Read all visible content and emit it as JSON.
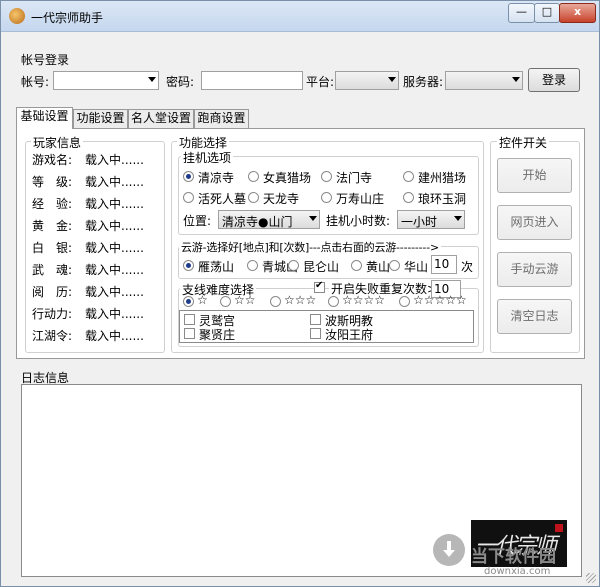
{
  "window": {
    "title": "一代宗师助手",
    "min_glyph": "—",
    "max_glyph": "□",
    "close_glyph": "x"
  },
  "login": {
    "group_title": "帐号登录",
    "account_label": "帐号:",
    "account_value": "",
    "password_label": "密码:",
    "password_value": "",
    "platform_label": "平台:",
    "platform_value": "",
    "server_label": "服务器:",
    "server_value": "",
    "login_button": "登录"
  },
  "tabs": [
    {
      "label": "基础设置",
      "active": true
    },
    {
      "label": "功能设置",
      "active": false
    },
    {
      "label": "名人堂设置",
      "active": false
    },
    {
      "label": "跑商设置",
      "active": false
    }
  ],
  "player_info": {
    "title": "玩家信息",
    "rows": [
      {
        "label": "游戏名:",
        "value": "载入中......"
      },
      {
        "label": "等　级:",
        "value": "载入中......"
      },
      {
        "label": "经　验:",
        "value": "载入中......"
      },
      {
        "label": "黄　金:",
        "value": "载入中......"
      },
      {
        "label": "白　银:",
        "value": "载入中......"
      },
      {
        "label": "武　魂:",
        "value": "载入中......"
      },
      {
        "label": "阅　历:",
        "value": "载入中......"
      },
      {
        "label": "行动力:",
        "value": "载入中......"
      },
      {
        "label": "江湖令:",
        "value": "载入中......"
      }
    ]
  },
  "function_select": {
    "title": "功能选择",
    "idle_title": "挂机选项",
    "idle_options": [
      {
        "label": "清凉寺",
        "selected": true
      },
      {
        "label": "女真猎场",
        "selected": false
      },
      {
        "label": "法门寺",
        "selected": false
      },
      {
        "label": "建州猎场",
        "selected": false
      },
      {
        "label": "活死人墓",
        "selected": false
      },
      {
        "label": "天龙寺",
        "selected": false
      },
      {
        "label": "万寿山庄",
        "selected": false
      },
      {
        "label": "琅环玉洞",
        "selected": false
      }
    ],
    "position_label": "位置:",
    "position_value": "清凉寺●山门",
    "hours_label": "挂机小时数:",
    "hours_value": "一小时",
    "cloud_title": "云游-选择好[地点]和[次数]---点击右面的云游--------->",
    "cloud_options": [
      {
        "label": "雁荡山",
        "selected": true
      },
      {
        "label": "青城山",
        "selected": false
      },
      {
        "label": "昆仑山",
        "selected": false
      },
      {
        "label": "黄山",
        "selected": false
      },
      {
        "label": "华山",
        "selected": false
      }
    ],
    "cloud_count": "10",
    "cloud_count_unit": "次",
    "branch_title": "支线难度选择",
    "retry_label": "开启失败重复次数>>",
    "retry_checked": true,
    "retry_count": "10",
    "stars": [
      {
        "label": "☆",
        "selected": true
      },
      {
        "label": "☆☆",
        "selected": false
      },
      {
        "label": "☆☆☆",
        "selected": false
      },
      {
        "label": "☆☆☆☆",
        "selected": false
      },
      {
        "label": "☆☆☆☆☆",
        "selected": false
      }
    ],
    "branch_list": [
      {
        "label": "灵鹫宫",
        "checked": false
      },
      {
        "label": "波斯明教",
        "checked": false
      },
      {
        "label": "聚贤庄",
        "checked": false
      },
      {
        "label": "汝阳王府",
        "checked": false
      }
    ]
  },
  "controls": {
    "title": "控件开关",
    "start": "开始",
    "web_enter": "网页进入",
    "manual_cloud": "手动云游",
    "clear_log": "清空日志"
  },
  "log": {
    "title": "日志信息",
    "content": ""
  },
  "watermark": {
    "logo_text": "一代宗师",
    "site_cn": "当下软件园",
    "site_en": "downxia.com"
  }
}
